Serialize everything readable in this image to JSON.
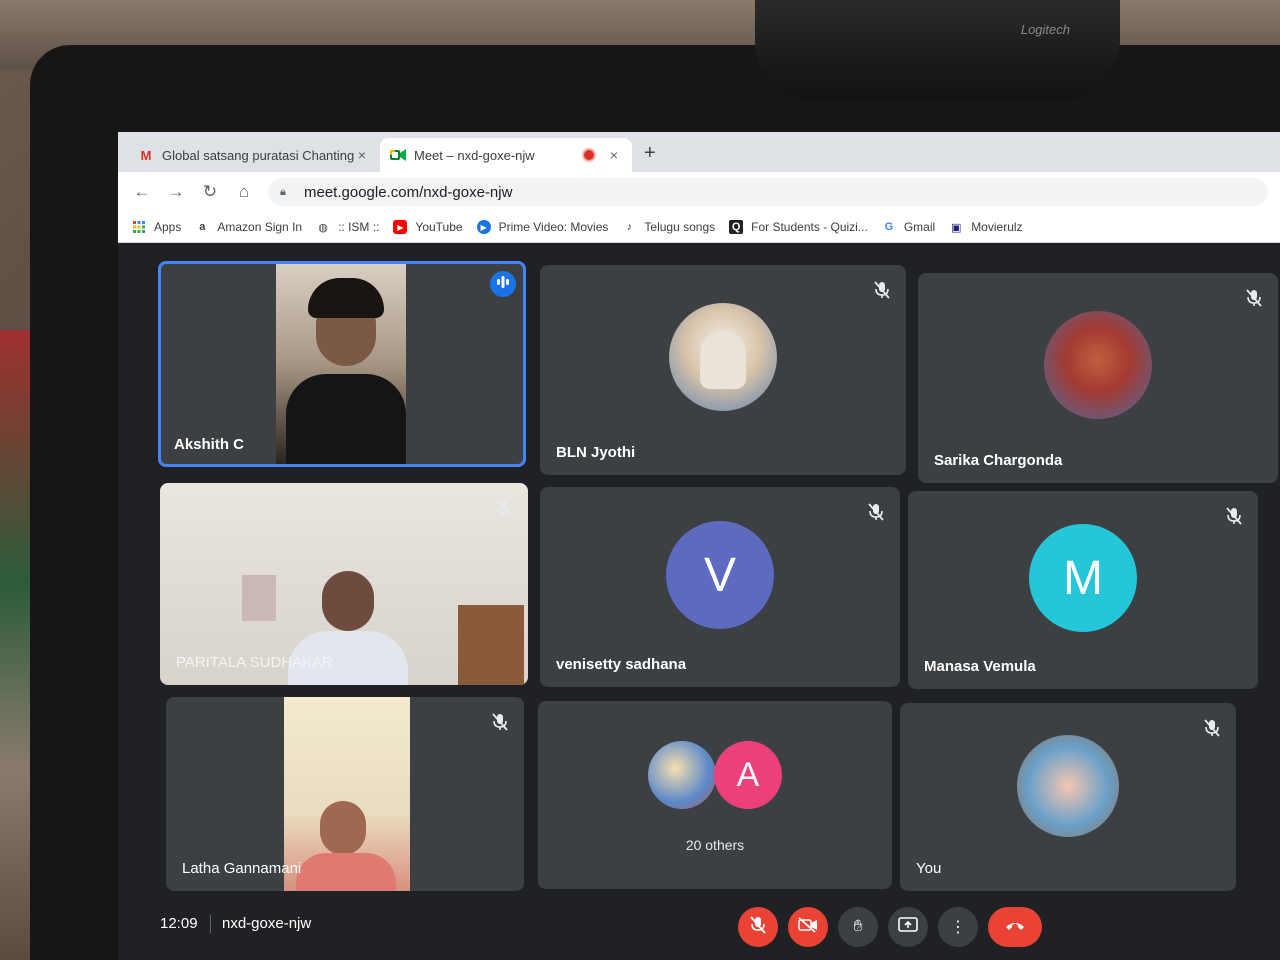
{
  "webcam_brand": "Logitech",
  "tabs": [
    {
      "title": "Global satsang puratasi Chanting",
      "favicon": "gmail-icon",
      "close": "×"
    },
    {
      "title": "Meet – nxd-goxe-njw",
      "favicon": "meet-icon",
      "close": "×"
    }
  ],
  "new_tab": "+",
  "nav": {
    "back": "←",
    "forward": "→",
    "reload": "↻",
    "home": "⌂"
  },
  "address": "meet.google.com/nxd-goxe-njw",
  "bookmarks": [
    {
      "label": "Apps",
      "icon": "apps-grid-icon"
    },
    {
      "label": "Amazon Sign In",
      "icon": "amazon-icon",
      "glyph": "a"
    },
    {
      "label": ":: ISM ::",
      "icon": "globe-icon",
      "glyph": "◍"
    },
    {
      "label": "YouTube",
      "icon": "youtube-icon",
      "glyph": "▶"
    },
    {
      "label": "Prime Video: Movies",
      "icon": "prime-video-icon",
      "glyph": "▶"
    },
    {
      "label": "Telugu songs",
      "icon": "music-icon",
      "glyph": "♪"
    },
    {
      "label": "For Students - Quizi...",
      "icon": "quizizz-icon",
      "glyph": "Q"
    },
    {
      "label": "Gmail",
      "icon": "google-icon",
      "glyph": "G"
    },
    {
      "label": "Movierulz",
      "icon": "movierulz-icon",
      "glyph": "▣"
    }
  ],
  "participants": [
    {
      "name": "Akshith C",
      "state": "speaking"
    },
    {
      "name": "BLN Jyothi",
      "state": "muted"
    },
    {
      "name": "Sarika Chargonda",
      "state": "muted"
    },
    {
      "name": "PARITALA SUDHAKAR",
      "state": "muted"
    },
    {
      "name": "venisetty sadhana",
      "state": "muted",
      "initial": "V"
    },
    {
      "name": "Manasa Vemula",
      "state": "muted",
      "initial": "M"
    },
    {
      "name": "Latha Gannamani",
      "state": "muted"
    },
    {
      "name": "20 others",
      "initial": "A"
    },
    {
      "name": "You",
      "state": "muted"
    }
  ],
  "colors": {
    "active_border": "#4285f4",
    "venisetty_avatar": "#5c6bc0",
    "manasa_avatar": "#26c6da",
    "others_avatar": "#ec407a",
    "end_call": "#ea4335"
  },
  "bottom": {
    "time": "12:09",
    "meeting_code": "nxd-goxe-njw",
    "controls": [
      {
        "name": "mic-off-button",
        "icon": "mic-off-icon"
      },
      {
        "name": "camera-off-button",
        "icon": "camera-off-icon"
      },
      {
        "name": "raise-hand-button",
        "icon": "hand-icon"
      },
      {
        "name": "present-button",
        "icon": "present-screen-icon"
      },
      {
        "name": "more-options-button",
        "icon": "more-vert-icon"
      },
      {
        "name": "end-call-button",
        "icon": "phone-hangup-icon"
      }
    ]
  }
}
